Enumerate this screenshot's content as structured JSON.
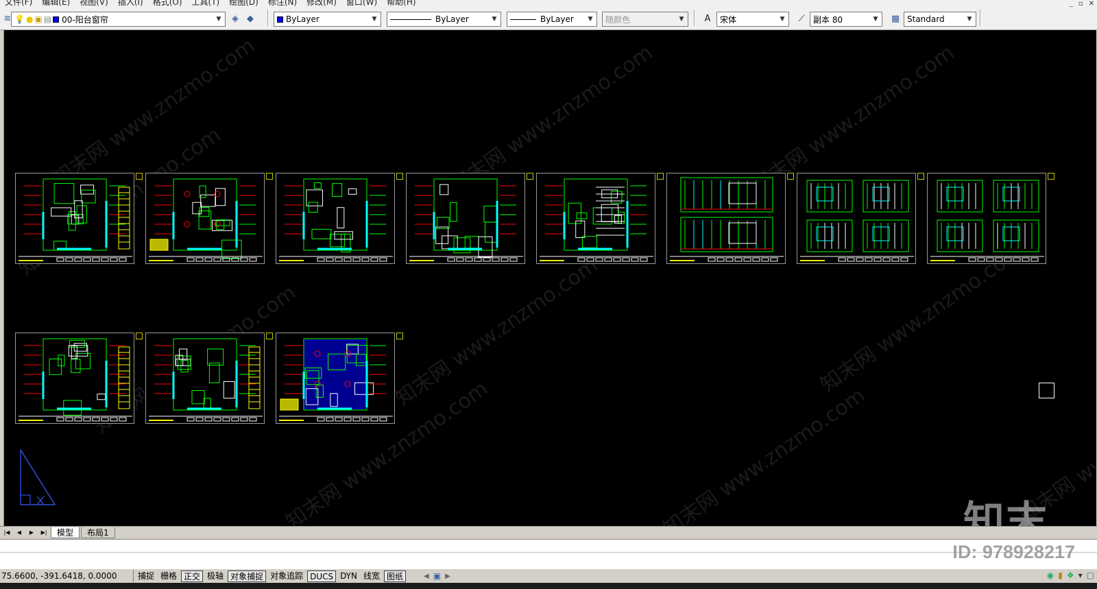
{
  "menus": [
    "文件(F)",
    "编辑(E)",
    "视图(V)",
    "插入(I)",
    "格式(O)",
    "工具(T)",
    "绘图(D)",
    "标注(N)",
    "修改(M)",
    "窗口(W)",
    "帮助(H)"
  ],
  "window_controls": [
    "_",
    "▫",
    "✕"
  ],
  "toolbar": {
    "layer_name": "00-阳台窗帘",
    "color_control": "ByLayer",
    "linetype_control": "ByLayer",
    "lineweight_control": "ByLayer",
    "plotstyle_control": "随颜色",
    "text_style": "宋体",
    "dim_style": "副本 80",
    "table_style": "Standard",
    "accent_color": "#0000ff"
  },
  "drawing": {
    "background": "#000000",
    "watermark_text": "知末网 www.znzmo.com",
    "logo_text": "知末",
    "sheet_palette": [
      "#00ff00",
      "#00ffff",
      "#ffff00",
      "#ff0000",
      "#ff00ff",
      "#ffffff",
      "#0000ff"
    ],
    "row1_sheet_kinds": [
      "plan",
      "ceiling",
      "plan-detail",
      "plan-detail",
      "plan-grid",
      "elevation",
      "elevation-4",
      "elevation-4"
    ],
    "row2_sheet_kinds": [
      "plan",
      "plan",
      "ceiling-blue"
    ]
  },
  "tabs": {
    "nav_icons": [
      "first-icon",
      "prev-icon",
      "next-icon",
      "last-icon"
    ],
    "model": "模型",
    "layout": "布局1"
  },
  "command": {
    "id_mark": "ID: 978928217"
  },
  "status": {
    "coordinates": "75.6600, -391.6418, 0.0000",
    "toggles": [
      {
        "label": "捕捉",
        "on": false
      },
      {
        "label": "栅格",
        "on": false
      },
      {
        "label": "正交",
        "on": true
      },
      {
        "label": "极轴",
        "on": false
      },
      {
        "label": "对象捕捉",
        "on": true
      },
      {
        "label": "对象追踪",
        "on": false
      },
      {
        "label": "DUCS",
        "on": true
      },
      {
        "label": "DYN",
        "on": false
      },
      {
        "label": "线宽",
        "on": false
      },
      {
        "label": "图纸",
        "on": true
      }
    ]
  }
}
